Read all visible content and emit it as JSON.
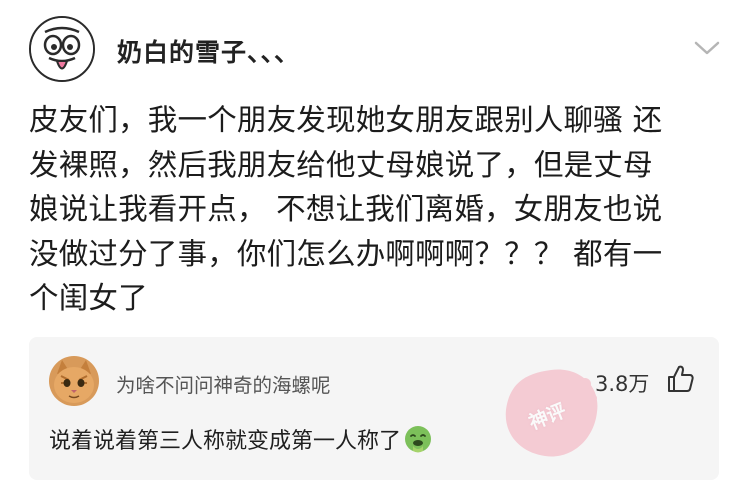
{
  "post": {
    "author_name": "奶白的雪子、、、",
    "lines": [
      "皮友们，我一个朋友发现她女朋友跟别人聊骚 还",
      "发裸照，然后我朋友给他丈母娘说了，但是丈母",
      "娘说让我看开点， 不想让我们离婚，女朋友也说",
      "没做过分了事，你们怎么办啊啊啊？？？ 都有一",
      "个闺女了"
    ]
  },
  "comment": {
    "commenter_name": "为啥不问问神奇的海螺呢",
    "like_count": "3.8万",
    "text": "说着说着第三人称就变成第一人称了",
    "emoji": "vomiting-face-emoji"
  },
  "watermark": {
    "label": "神评"
  },
  "icons": {
    "expand": "chevron-down-icon",
    "like": "thumbs-up-icon"
  },
  "colors": {
    "card_background": "#f5f5f5",
    "watermark": "#f4a9b8"
  }
}
